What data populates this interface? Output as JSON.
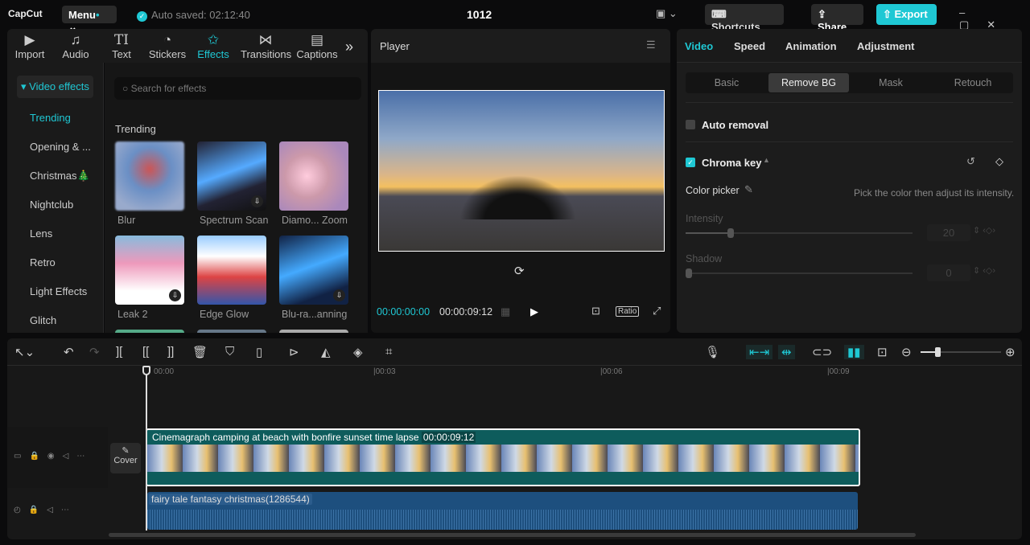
{
  "app": {
    "logo": "CapCut",
    "menu": "Menu",
    "autosave": "Auto saved: 02:12:40",
    "title": "1012",
    "shortcuts": "Shortcuts",
    "share": "Share",
    "export": "Export"
  },
  "tabs": [
    {
      "label": "Import",
      "icon": "▶"
    },
    {
      "label": "Audio",
      "icon": "♫"
    },
    {
      "label": "Text",
      "icon": "TI"
    },
    {
      "label": "Stickers",
      "icon": "◔"
    },
    {
      "label": "Effects",
      "icon": "✩"
    },
    {
      "label": "Transitions",
      "icon": "⋈"
    },
    {
      "label": "Captions",
      "icon": "▤"
    }
  ],
  "sidebar": {
    "header": "Video effects",
    "items": [
      "Trending",
      "Opening & ...",
      "Christmas🎄",
      "Nightclub",
      "Lens",
      "Retro",
      "Light Effects",
      "Glitch"
    ]
  },
  "effects": {
    "search_placeholder": "Search for effects",
    "section": "Trending",
    "items": [
      {
        "name": "Blur"
      },
      {
        "name": "Spectrum Scan"
      },
      {
        "name": "Diamo... Zoom"
      },
      {
        "name": "Leak 2"
      },
      {
        "name": "Edge Glow"
      },
      {
        "name": "Blu-ra...anning"
      }
    ]
  },
  "player": {
    "title": "Player",
    "current": "00:00:00:00",
    "duration": "00:00:09:12",
    "ratio": "Ratio"
  },
  "right": {
    "tabs": [
      "Video",
      "Speed",
      "Animation",
      "Adjustment"
    ],
    "segments": [
      "Basic",
      "Remove BG",
      "Mask",
      "Retouch"
    ],
    "auto_removal": "Auto removal",
    "chroma_key": "Chroma key",
    "color_picker": "Color picker",
    "hint": "Pick the color then adjust its intensity.",
    "intensity_label": "Intensity",
    "intensity_value": "20",
    "intensity_fraction": 0.2,
    "shadow_label": "Shadow",
    "shadow_value": "0"
  },
  "timeline": {
    "ticks": [
      "00:00",
      "|00:03",
      "|00:06",
      "|00:09"
    ],
    "cover": "Cover",
    "video_clip": "Cinemagraph camping at beach with bonfire sunset time lapse",
    "video_duration": "00:00:09:12",
    "audio_clip": "fairy tale fantasy christmas(1286544)"
  },
  "colors": {
    "accent": "#1fc8d4",
    "video_track": "#0e5c5c",
    "audio_track": "#1d4f7e"
  }
}
